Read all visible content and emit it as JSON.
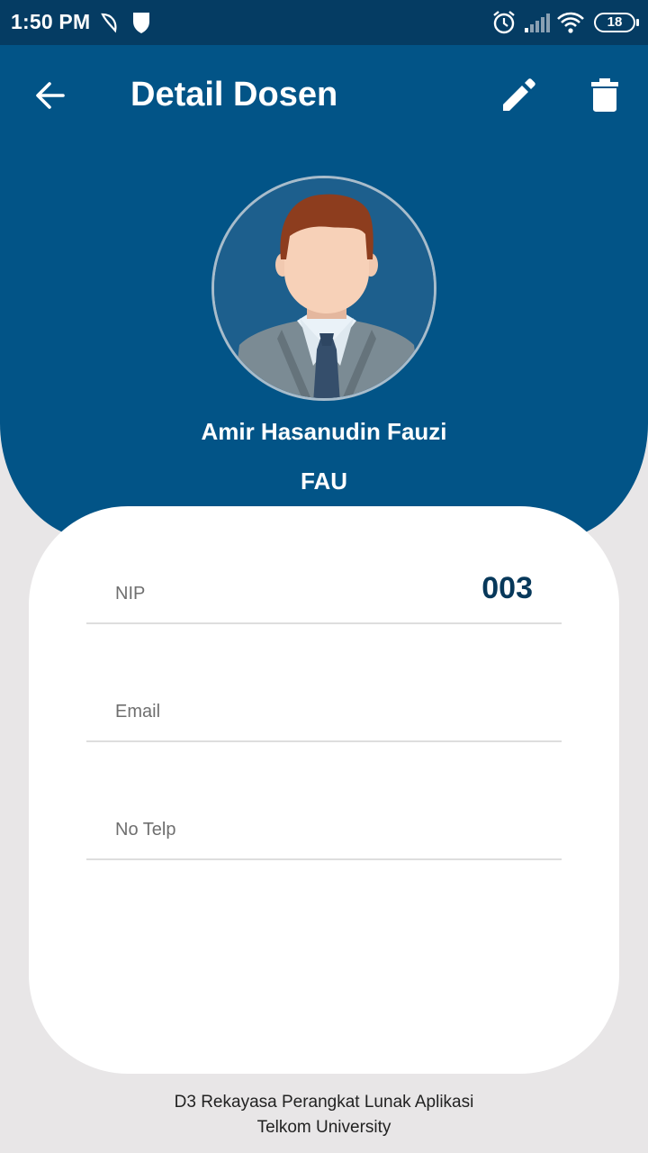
{
  "status_bar": {
    "time": "1:50 PM",
    "battery": "18",
    "icons": [
      "moon-icon",
      "shield-icon",
      "alarm-icon",
      "signal-icon",
      "wifi-icon",
      "battery-icon"
    ]
  },
  "toolbar": {
    "title": "Detail Dosen",
    "back_icon": "arrow-left-icon",
    "edit_icon": "pencil-icon",
    "delete_icon": "trash-icon"
  },
  "profile": {
    "avatar_icon": "person-avatar-icon",
    "name": "Amir Hasanudin Fauzi",
    "code": "FAU"
  },
  "fields": [
    {
      "label": "NIP",
      "value": "003"
    },
    {
      "label": "Email",
      "value": ""
    },
    {
      "label": "No Telp",
      "value": ""
    }
  ],
  "footer": {
    "line1": "D3 Rekayasa Perangkat Lunak Aplikasi",
    "line2": "Telkom University"
  },
  "colors": {
    "header": "#025487",
    "status_bar": "#053c63",
    "background": "#e8e6e7",
    "value_text": "#07385a"
  }
}
